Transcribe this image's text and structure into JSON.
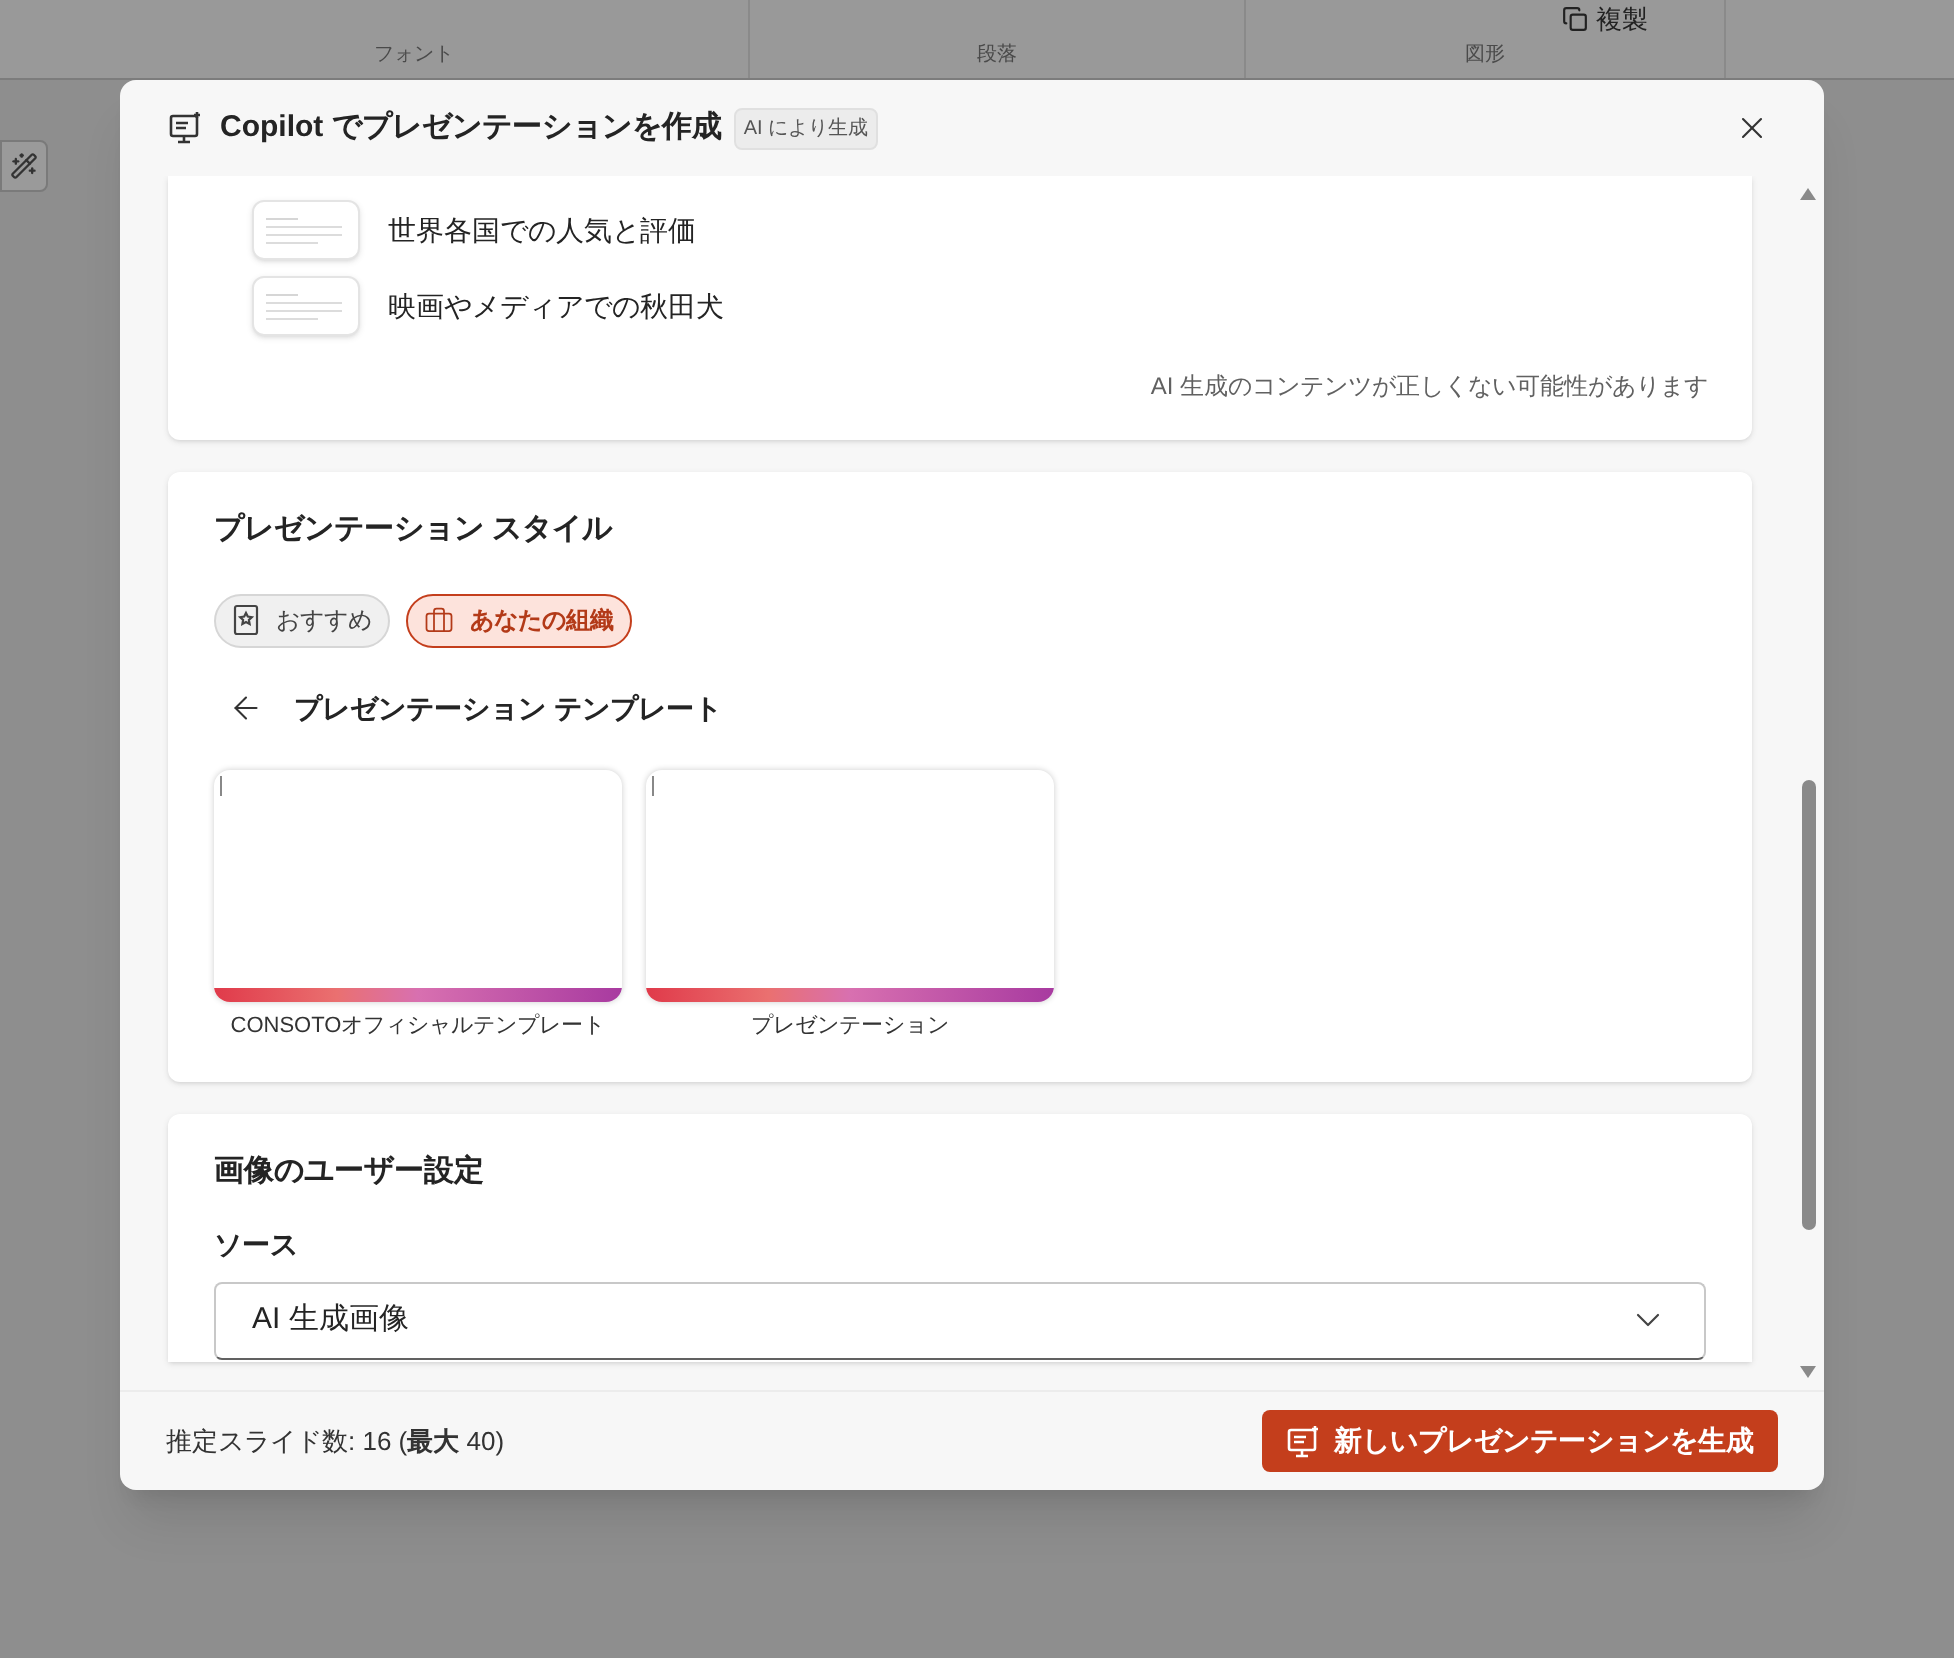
{
  "ribbon": {
    "groups": [
      {
        "label": "フォント"
      },
      {
        "label": "段落"
      },
      {
        "label": "図形"
      }
    ],
    "duplicate_button": "複製"
  },
  "dialog": {
    "title": "Copilot でプレゼンテーションを作成",
    "badge": "AI により生成",
    "outline": {
      "items": [
        "世界各国での人気と評価",
        "映画やメディアでの秋田犬"
      ],
      "disclaimer": "AI 生成のコンテンツが正しくない可能性があります"
    },
    "style": {
      "heading": "プレゼンテーション スタイル",
      "filters": [
        {
          "label": "おすすめ",
          "selected": false
        },
        {
          "label": "あなたの組織",
          "selected": true
        }
      ],
      "back_label": "プレゼンテーション テンプレート",
      "templates": [
        {
          "name": "CONSOTOオフィシャルテンプレート"
        },
        {
          "name": "プレゼンテーション"
        }
      ]
    },
    "image_settings": {
      "heading": "画像のユーザー設定",
      "source_label": "ソース",
      "source_value": "AI 生成画像"
    },
    "footer": {
      "estimate": "推定スライド数: 16 (**最大** 40)",
      "generate_button": "新しいプレゼンテーションを生成"
    }
  }
}
